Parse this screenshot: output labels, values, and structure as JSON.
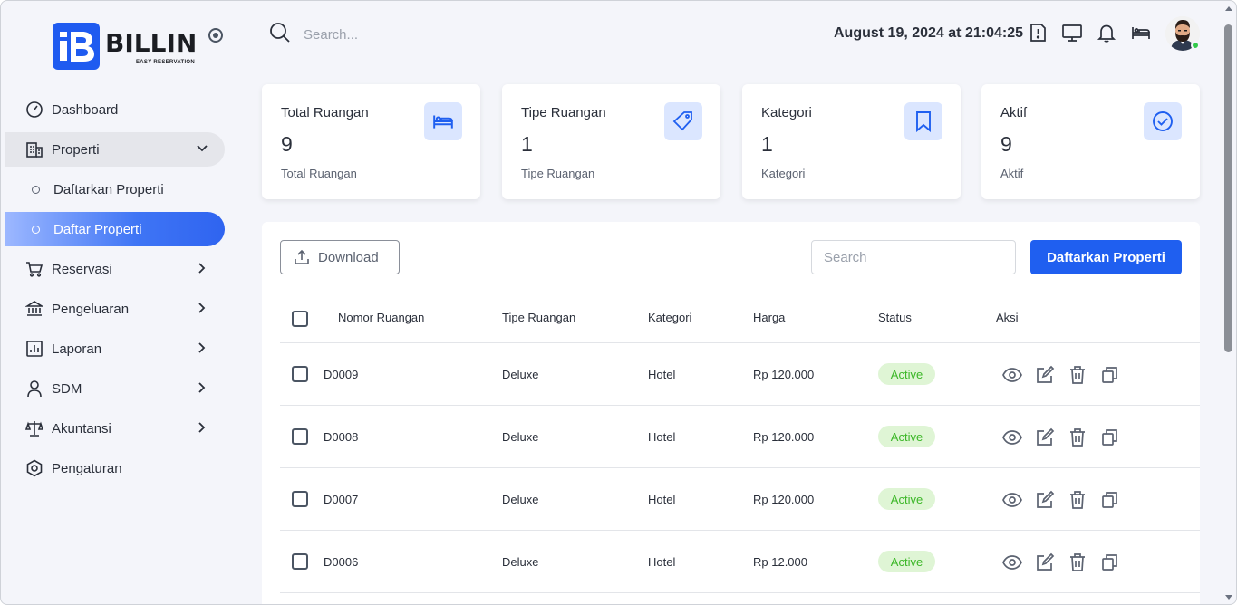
{
  "brand": {
    "name": "BILLIN",
    "tagline": "EASY RESERVATION",
    "mark": "B"
  },
  "topbar": {
    "search_placeholder": "Search...",
    "datetime": "August 19, 2024 at 21:04:25",
    "icons": [
      "alert-icon",
      "monitor-icon",
      "bell-icon",
      "bed-icon"
    ]
  },
  "sidebar": {
    "items": [
      {
        "label": "Dashboard",
        "icon": "gauge-icon"
      },
      {
        "label": "Properti",
        "icon": "building-icon"
      },
      {
        "label": "Daftarkan Properti"
      },
      {
        "label": "Daftar Properti"
      },
      {
        "label": "Reservasi",
        "icon": "cart-icon"
      },
      {
        "label": "Pengeluaran",
        "icon": "bank-icon"
      },
      {
        "label": "Laporan",
        "icon": "report-icon"
      },
      {
        "label": "SDM",
        "icon": "user-icon"
      },
      {
        "label": "Akuntansi",
        "icon": "scale-icon"
      },
      {
        "label": "Pengaturan",
        "icon": "settings-icon"
      }
    ]
  },
  "stats": [
    {
      "title": "Total Ruangan",
      "value": "9",
      "sub": "Total Ruangan",
      "icon": "bed-icon"
    },
    {
      "title": "Tipe Ruangan",
      "value": "1",
      "sub": "Tipe Ruangan",
      "icon": "tag-icon"
    },
    {
      "title": "Kategori",
      "value": "1",
      "sub": "Kategori",
      "icon": "bookmark-icon"
    },
    {
      "title": "Aktif",
      "value": "9",
      "sub": "Aktif",
      "icon": "check-circle-icon"
    }
  ],
  "table": {
    "download_label": "Download",
    "search_placeholder": "Search",
    "primary_label": "Daftarkan Properti",
    "headers": [
      "Nomor Ruangan",
      "Tipe Ruangan",
      "Kategori",
      "Harga",
      "Status",
      "Aksi"
    ],
    "rows": [
      {
        "nomor": "D0009",
        "tipe": "Deluxe",
        "kategori": "Hotel",
        "harga": "Rp 120.000",
        "status": "Active"
      },
      {
        "nomor": "D0008",
        "tipe": "Deluxe",
        "kategori": "Hotel",
        "harga": "Rp 120.000",
        "status": "Active"
      },
      {
        "nomor": "D0007",
        "tipe": "Deluxe",
        "kategori": "Hotel",
        "harga": "Rp 120.000",
        "status": "Active"
      },
      {
        "nomor": "D0006",
        "tipe": "Deluxe",
        "kategori": "Hotel",
        "harga": "Rp 12.000",
        "status": "Active"
      }
    ]
  },
  "colors": {
    "accent": "#1f5ff0",
    "active_badge_bg": "#dff5d5",
    "active_badge_text": "#3cb728",
    "icon_tile": "#dbe6ff"
  }
}
